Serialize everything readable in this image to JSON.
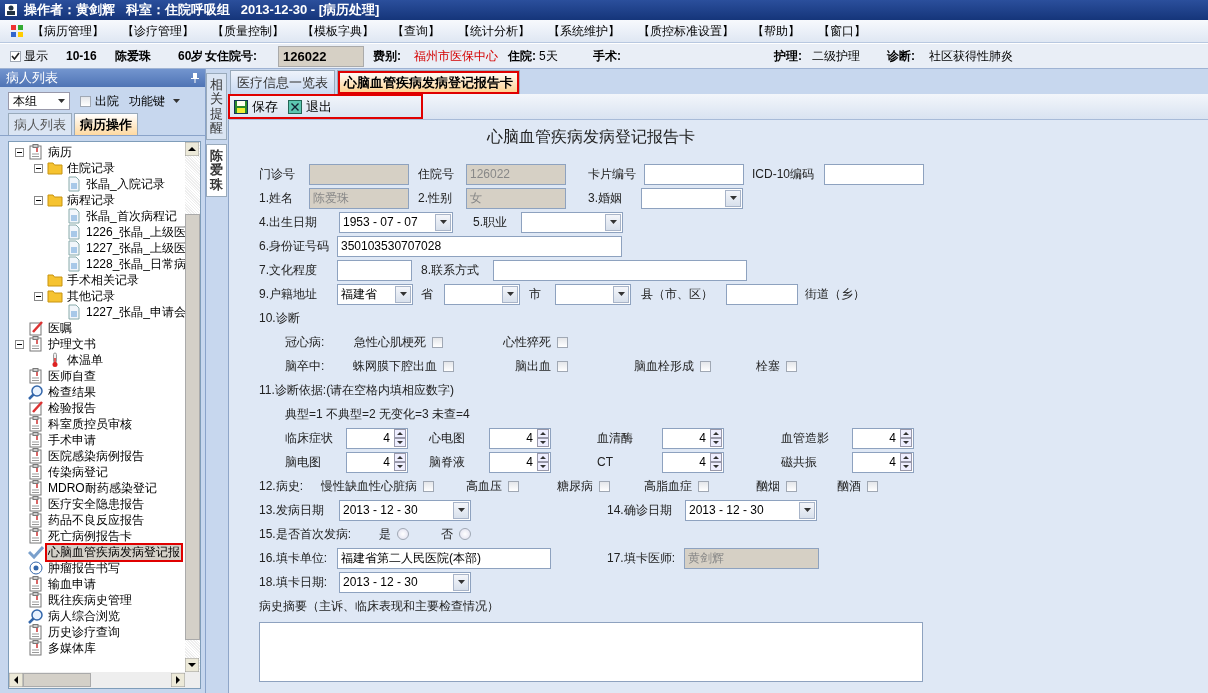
{
  "title_bar": {
    "title": "操作者：黄剑辉   科室：住院呼吸组   2013-12-30 - [病历处理]"
  },
  "menu": [
    "【病历管理】",
    "【诊疗管理】",
    "【质量控制】",
    "【模板字典】",
    "【查询】",
    "【统计分析】",
    "【系统维护】",
    "【质控标准设置】",
    "【帮助】",
    "【窗口】"
  ],
  "patient_bar": {
    "show": {
      "label": "显示",
      "checked": true
    },
    "bed": "10-16",
    "name": "陈爱珠",
    "age": "60岁",
    "gender": "女",
    "admission_label": "住院号:",
    "admission_no": "126022",
    "fee_label": "费别:",
    "fee_value": "福州市医保中心",
    "stay_label": "住院:",
    "stay_value": "5天",
    "surgery_label": "手术:",
    "nursing_label": "护理:",
    "nursing_value": "二级护理",
    "diagnosis_label": "诊断:",
    "diagnosis_value": "社区获得性肺炎"
  },
  "left_panel": {
    "title": "病人列表",
    "group": "本组",
    "discharged": {
      "label": "出院",
      "checked": false
    },
    "function_key": "功能键",
    "tabs": [
      {
        "label": "病人列表",
        "selected": false
      },
      {
        "label": "病历操作",
        "selected": true
      }
    ],
    "tree": [
      {
        "label": "病历",
        "kind": "clipboard",
        "selected": false,
        "highlighted": false,
        "expanded": true,
        "children": [
          {
            "label": "住院记录",
            "kind": "folder",
            "selected": false,
            "highlighted": false,
            "expanded": true,
            "children": [
              {
                "label": "张晶_入院记录",
                "kind": "document",
                "selected": false,
                "highlighted": false
              }
            ]
          },
          {
            "label": "病程记录",
            "kind": "folder",
            "selected": false,
            "highlighted": false,
            "expanded": true,
            "children": [
              {
                "label": "张晶_首次病程记",
                "kind": "document",
                "selected": false,
                "highlighted": false
              },
              {
                "label": "1226_张晶_上级医",
                "kind": "document",
                "selected": false,
                "highlighted": false
              },
              {
                "label": "1227_张晶_上级医",
                "kind": "document",
                "selected": false,
                "highlighted": false
              },
              {
                "label": "1228_张晶_日常病",
                "kind": "document",
                "selected": false,
                "highlighted": false
              }
            ]
          },
          {
            "label": "手术相关记录",
            "kind": "folder",
            "selected": false,
            "highlighted": false
          },
          {
            "label": "其他记录",
            "kind": "folder",
            "selected": false,
            "highlighted": false,
            "expanded": true,
            "children": [
              {
                "label": "1227_张晶_申请会",
                "kind": "document",
                "selected": false,
                "highlighted": false
              }
            ]
          }
        ]
      },
      {
        "label": "医嘱",
        "kind": "pencil",
        "selected": false,
        "highlighted": false
      },
      {
        "label": "护理文书",
        "kind": "clipboard",
        "selected": false,
        "highlighted": false,
        "expanded": true,
        "children": [
          {
            "label": "体温单",
            "kind": "thermometer",
            "selected": false,
            "highlighted": false
          }
        ]
      },
      {
        "label": "医师自查",
        "kind": "clipboard",
        "selected": false,
        "highlighted": false
      },
      {
        "label": "检查结果",
        "kind": "magnifier",
        "selected": false,
        "highlighted": false
      },
      {
        "label": "检验报告",
        "kind": "pencil",
        "selected": false,
        "highlighted": false
      },
      {
        "label": "科室质控员审核",
        "kind": "clipboard",
        "selected": false,
        "highlighted": false
      },
      {
        "label": "手术申请",
        "kind": "clipboard",
        "selected": false,
        "highlighted": false
      },
      {
        "label": "医院感染病例报告",
        "kind": "clipboard",
        "selected": false,
        "highlighted": false
      },
      {
        "label": "传染病登记",
        "kind": "clipboard",
        "selected": false,
        "highlighted": false
      },
      {
        "label": "MDRO耐药感染登记",
        "kind": "clipboard",
        "selected": false,
        "highlighted": false
      },
      {
        "label": "医疗安全隐患报告",
        "kind": "clipboard",
        "selected": false,
        "highlighted": false
      },
      {
        "label": "药品不良反应报告",
        "kind": "clipboard",
        "selected": false,
        "highlighted": false
      },
      {
        "label": "死亡病例报告卡",
        "kind": "clipboard",
        "selected": false,
        "highlighted": false
      },
      {
        "label": "心脑血管疾病发病登记报",
        "kind": "checkmark",
        "selected": true,
        "highlighted": true
      },
      {
        "label": "肿瘤报告书写",
        "kind": "target",
        "selected": false,
        "highlighted": false
      },
      {
        "label": "输血申请",
        "kind": "clipboard",
        "selected": false,
        "highlighted": false
      },
      {
        "label": "既往疾病史管理",
        "kind": "clipboard",
        "selected": false,
        "highlighted": false
      },
      {
        "label": "病人综合浏览",
        "kind": "magnifier",
        "selected": false,
        "highlighted": false
      },
      {
        "label": "历史诊疗查询",
        "kind": "clipboard",
        "selected": false,
        "highlighted": false
      },
      {
        "label": "多媒体库",
        "kind": "clipboard",
        "selected": false,
        "highlighted": false
      }
    ]
  },
  "side_tabs": [
    {
      "label": "相关提醒",
      "selected": false
    },
    {
      "label": "陈爱珠",
      "selected": true
    }
  ],
  "main_tabs": [
    {
      "label": "医疗信息一览表",
      "selected": false,
      "highlighted": false
    },
    {
      "label": "心脑血管疾病发病登记报告卡",
      "selected": true,
      "highlighted": true
    }
  ],
  "toolbar": {
    "highlighted": true,
    "buttons": [
      {
        "label": "保存",
        "kind": "save"
      },
      {
        "label": "退出",
        "kind": "exit"
      }
    ]
  },
  "form": {
    "title": "心脑血管疾病发病登记报告卡",
    "rows": [
      {
        "items": [
          {
            "kind": "label",
            "text": "门诊号"
          },
          {
            "kind": "text",
            "disabled": true
          },
          {
            "kind": "label",
            "text": "住院号"
          },
          {
            "kind": "text",
            "value": "126022",
            "disabled": true
          },
          {
            "kind": "label",
            "text": "卡片编号"
          },
          {
            "kind": "text",
            "disabled": false
          },
          {
            "kind": "label",
            "text": "ICD-10编码"
          },
          {
            "kind": "text",
            "disabled": false
          }
        ]
      },
      {
        "items": [
          {
            "kind": "label",
            "text": "1.姓名"
          },
          {
            "kind": "text",
            "value": "陈爱珠",
            "disabled": true
          },
          {
            "kind": "label",
            "text": "2.性别"
          },
          {
            "kind": "text",
            "value": "女",
            "disabled": true
          },
          {
            "kind": "label",
            "text": "3.婚姻"
          },
          {
            "kind": "select"
          }
        ]
      },
      {
        "items": [
          {
            "kind": "label",
            "text": "4.出生日期"
          },
          {
            "kind": "date",
            "value": "1953 - 07 - 07"
          },
          {
            "kind": "label",
            "text": "5.职业"
          },
          {
            "kind": "select"
          }
        ]
      },
      {
        "items": [
          {
            "kind": "label",
            "text": "6.身份证号码"
          },
          {
            "kind": "text",
            "value": "350103530707028",
            "disabled": false
          }
        ]
      },
      {
        "items": [
          {
            "kind": "label",
            "text": "7.文化程度"
          },
          {
            "kind": "text",
            "disabled": false
          },
          {
            "kind": "label",
            "text": "8.联系方式"
          },
          {
            "kind": "text",
            "disabled": false
          }
        ]
      },
      {
        "items": [
          {
            "kind": "label",
            "text": "9.户籍地址"
          },
          {
            "kind": "select",
            "value": "福建省"
          },
          {
            "kind": "label",
            "text": "省"
          },
          {
            "kind": "select"
          },
          {
            "kind": "label",
            "text": "市"
          },
          {
            "kind": "select"
          },
          {
            "kind": "label",
            "text": "县（市、区）"
          },
          {
            "kind": "text",
            "disabled": false
          },
          {
            "kind": "label",
            "text": "街道（乡）"
          }
        ]
      },
      {
        "items": [
          {
            "kind": "label",
            "text": "10.诊断"
          }
        ]
      },
      {
        "items": [
          {
            "kind": "label",
            "text": "冠心病:"
          },
          {
            "kind": "check",
            "text": "急性心肌梗死",
            "checked": false
          },
          {
            "kind": "check",
            "text": "心性猝死",
            "checked": false
          }
        ]
      },
      {
        "items": [
          {
            "kind": "label",
            "text": "脑卒中:"
          },
          {
            "kind": "check",
            "text": "蛛网膜下腔出血",
            "checked": false
          },
          {
            "kind": "check",
            "text": "脑出血",
            "checked": false
          },
          {
            "kind": "check",
            "text": "脑血栓形成",
            "checked": false
          },
          {
            "kind": "check",
            "text": "栓塞",
            "checked": false
          }
        ]
      },
      {
        "items": [
          {
            "kind": "label",
            "text": "11.诊断依据:(请在空格内填相应数字)"
          }
        ]
      },
      {
        "items": [
          {
            "kind": "label",
            "text": "典型=1  不典型=2  无变化=3  未查=4"
          }
        ]
      },
      {
        "items": [
          {
            "kind": "label",
            "text": "临床症状"
          },
          {
            "kind": "spin",
            "value": "4"
          },
          {
            "kind": "label",
            "text": "心电图"
          },
          {
            "kind": "spin",
            "value": "4"
          },
          {
            "kind": "label",
            "text": "血清酶"
          },
          {
            "kind": "spin",
            "value": "4"
          },
          {
            "kind": "label",
            "text": "血管造影"
          },
          {
            "kind": "spin",
            "value": "4"
          }
        ]
      },
      {
        "items": [
          {
            "kind": "label",
            "text": "脑电图"
          },
          {
            "kind": "spin",
            "value": "4"
          },
          {
            "kind": "label",
            "text": "脑脊液"
          },
          {
            "kind": "spin",
            "value": "4"
          },
          {
            "kind": "label",
            "text": "CT"
          },
          {
            "kind": "spin",
            "value": "4"
          },
          {
            "kind": "label",
            "text": "磁共振"
          },
          {
            "kind": "spin",
            "value": "4"
          }
        ]
      },
      {
        "items": [
          {
            "kind": "label",
            "text": "12.病史:"
          },
          {
            "kind": "check",
            "text": "慢性缺血性心脏病",
            "checked": false
          },
          {
            "kind": "check",
            "text": "高血压",
            "checked": false
          },
          {
            "kind": "check",
            "text": "糖尿病",
            "checked": false
          },
          {
            "kind": "check",
            "text": "高脂血症",
            "checked": false
          },
          {
            "kind": "check",
            "text": "酗烟",
            "checked": false
          },
          {
            "kind": "check",
            "text": "酗酒",
            "checked": false
          }
        ]
      },
      {
        "items": [
          {
            "kind": "label",
            "text": "13.发病日期"
          },
          {
            "kind": "date",
            "value": "2013 - 12 - 30"
          },
          {
            "kind": "label",
            "text": "14.确诊日期"
          },
          {
            "kind": "date",
            "value": "2013 - 12 - 30"
          }
        ]
      },
      {
        "items": [
          {
            "kind": "label",
            "text": "15.是否首次发病:"
          },
          {
            "kind": "radio",
            "text": "是",
            "selected": false
          },
          {
            "kind": "radio",
            "text": "否",
            "selected": false
          }
        ]
      },
      {
        "items": [
          {
            "kind": "label",
            "text": "16.填卡单位:"
          },
          {
            "kind": "text",
            "value": "福建省第二人民医院(本部)",
            "disabled": false
          },
          {
            "kind": "label",
            "text": "17.填卡医师:"
          },
          {
            "kind": "text",
            "value": "黄剑辉",
            "disabled": true
          }
        ]
      },
      {
        "items": [
          {
            "kind": "label",
            "text": "18.填卡日期:"
          },
          {
            "kind": "date",
            "value": "2013 - 12 - 30"
          }
        ]
      },
      {
        "items": [
          {
            "kind": "label",
            "text": "病史摘要（主诉、临床表现和主要检查情况）"
          }
        ]
      }
    ]
  }
}
